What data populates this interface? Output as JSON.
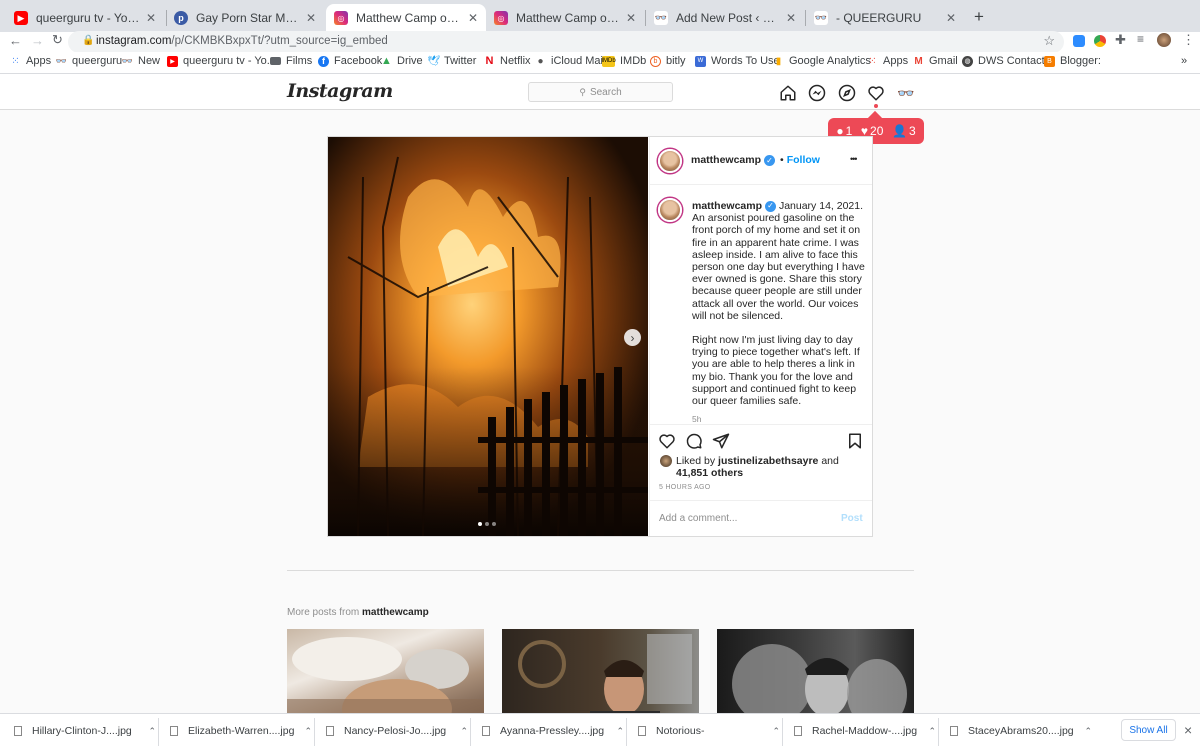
{
  "browser": {
    "tabs": [
      {
        "title": "queerguru tv - YouTube",
        "icon": "youtube-icon",
        "color": "#ff0000"
      },
      {
        "title": "Gay Porn Star Matthew Camp L",
        "icon": "wordpress-icon",
        "color": "#21759b"
      },
      {
        "title": "Matthew Camp on Instagram: \"",
        "icon": "instagram-icon",
        "color": "#c13584"
      },
      {
        "title": "Matthew Camp on Instagram: \"",
        "icon": "instagram-icon",
        "color": "#c13584"
      },
      {
        "title": "Add New Post ‹ QUEERGURU —",
        "icon": "queerguru-icon",
        "color": "#888888"
      },
      {
        "title": "- QUEERGURU",
        "icon": "queerguru-icon",
        "color": "#888888"
      }
    ],
    "url_host": "instagram.com",
    "url_path": "/p/CKMBKBxpxTt/?utm_source=ig_embed",
    "bookmarks": [
      {
        "label": "Apps",
        "icon": "apps-grid-icon"
      },
      {
        "label": "queerguru",
        "icon": "queerguru-icon"
      },
      {
        "label": "New",
        "icon": "queerguru-icon"
      },
      {
        "label": "queerguru tv - Yo...",
        "icon": "youtube-icon"
      },
      {
        "label": "Films",
        "icon": "folder-icon"
      },
      {
        "label": "Facebook",
        "icon": "facebook-icon"
      },
      {
        "label": "Drive",
        "icon": "drive-icon"
      },
      {
        "label": "Twitter",
        "icon": "twitter-icon"
      },
      {
        "label": "Netflix",
        "icon": "netflix-icon"
      },
      {
        "label": "iCloud Mail",
        "icon": "apple-icon"
      },
      {
        "label": "IMDb",
        "icon": "imdb-icon"
      },
      {
        "label": "bitly",
        "icon": "bitly-icon"
      },
      {
        "label": "Words To Use",
        "icon": "thesaurus-icon"
      },
      {
        "label": "Google Analytics",
        "icon": "analytics-icon"
      },
      {
        "label": "Apps",
        "icon": "apps-grid-icon"
      },
      {
        "label": "Gmail",
        "icon": "gmail-icon"
      },
      {
        "label": "DWS Contacts",
        "icon": "globe-icon"
      },
      {
        "label": "Blogger:",
        "icon": "blogger-icon"
      }
    ],
    "bookmarks_more": "»"
  },
  "instagram": {
    "logo": "Instagram",
    "search_placeholder": "Search",
    "notifications": {
      "comments": "1",
      "likes": "20",
      "follows": "3"
    },
    "post": {
      "username": "matthewcamp",
      "follow_label": "Follow",
      "follow_sep": "•",
      "more": "•••",
      "date": "January 14, 2021.",
      "caption_p1": "An arsonist poured gasoline on the front porch of my home and set it on fire in an apparent hate crime. I was asleep inside. I am alive to face this person one day but everything I have ever owned is gone. Share this story because queer people are still under attack all over the world. Our voices will not be silenced.",
      "caption_p2": "Right now I'm just living day to day trying to piece together what's left. If you are able to help theres a link in my bio. Thank you for the love and support and continued fight to keep our queer families safe.",
      "caption_age": "5h",
      "liked_by_prefix": "Liked by",
      "liked_by_user": "justinelizabethsayre",
      "liked_by_and": "and",
      "likes_others": "41,851 others",
      "time_ago": "5 HOURS AGO",
      "comment_placeholder": "Add a comment...",
      "post_button": "Post",
      "carousel_count": 3,
      "carousel_active": 1
    },
    "more_posts_prefix": "More posts from",
    "more_posts_user": "matthewcamp"
  },
  "downloads": {
    "items": [
      "Hillary-Clinton-J....jpg",
      "Elizabeth-Warren....jpg",
      "Nancy-Pelosi-Jo....jpg",
      "Ayanna-Pressley....jpg",
      "Notorious-",
      "Rachel-Maddow-....jpg",
      "StaceyAbrams20....jpg"
    ],
    "show_all": "Show All",
    "close": "×"
  },
  "colors": {
    "accent": "#0095f6",
    "notif": "#ed4956",
    "brand": "#c13584"
  }
}
